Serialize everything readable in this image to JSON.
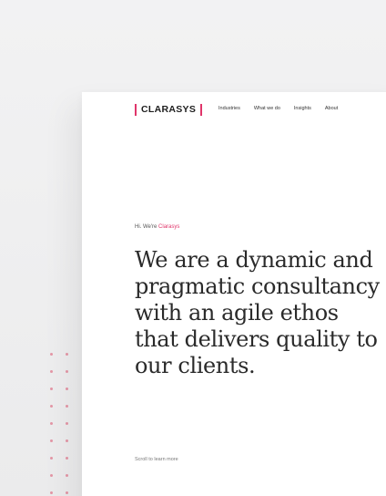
{
  "logo": {
    "text": "CLARASYS",
    "accent_color": "#e0356a"
  },
  "nav": {
    "items": [
      {
        "label": "Industries"
      },
      {
        "label": "What we do"
      },
      {
        "label": "Insights"
      },
      {
        "label": "About"
      }
    ]
  },
  "hero": {
    "greeting_prefix": "Hi. We're ",
    "greeting_brand": "Clarasys",
    "headline_lines": [
      "We are a dynamic and",
      "pragmatic consultancy",
      "with an agile ethos",
      "that delivers quality to",
      "our clients."
    ],
    "scroll_hint": "Scroll to learn more"
  }
}
